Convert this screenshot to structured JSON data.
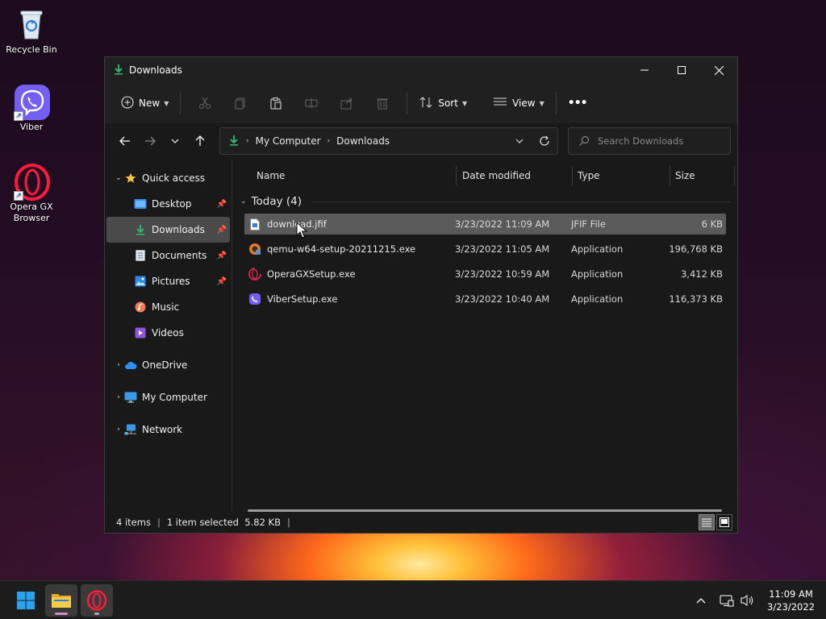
{
  "desktop": {
    "icons": [
      {
        "label": "Recycle Bin"
      },
      {
        "label": "Viber"
      },
      {
        "label": "Opera GX Browser"
      }
    ]
  },
  "window": {
    "title": "Downloads",
    "toolbar": {
      "new_label": "New",
      "sort_label": "Sort",
      "view_label": "View",
      "more_label": "•••"
    },
    "address": {
      "crumbs": [
        "My Computer",
        "Downloads"
      ]
    },
    "search": {
      "placeholder": "Search Downloads"
    },
    "sidebar": {
      "items": [
        {
          "label": "Quick access"
        },
        {
          "label": "Desktop"
        },
        {
          "label": "Downloads"
        },
        {
          "label": "Documents"
        },
        {
          "label": "Pictures"
        },
        {
          "label": "Music"
        },
        {
          "label": "Videos"
        },
        {
          "label": "OneDrive"
        },
        {
          "label": "My Computer"
        },
        {
          "label": "Network"
        }
      ]
    },
    "columns": {
      "name": "Name",
      "date": "Date modified",
      "type": "Type",
      "size": "Size"
    },
    "group": {
      "label": "Today (4)"
    },
    "files": [
      {
        "name": "download.jfif",
        "date": "3/23/2022 11:09 AM",
        "type": "JFIF File",
        "size": "6 KB"
      },
      {
        "name": "qemu-w64-setup-20211215.exe",
        "date": "3/23/2022 11:05 AM",
        "type": "Application",
        "size": "196,768 KB"
      },
      {
        "name": "OperaGXSetup.exe",
        "date": "3/23/2022 10:59 AM",
        "type": "Application",
        "size": "3,412 KB"
      },
      {
        "name": "ViberSetup.exe",
        "date": "3/23/2022 10:40 AM",
        "type": "Application",
        "size": "116,373 KB"
      }
    ],
    "status": {
      "count": "4 items",
      "selection": "1 item selected  5.82 KB"
    }
  },
  "taskbar": {
    "time": "11:09 AM",
    "date": "3/23/2022"
  },
  "colors": {
    "accent_green": "#2fb36b",
    "folder_yellow": "#f3c242",
    "opera_red": "#e8202f",
    "viber_purple": "#7360f2"
  }
}
